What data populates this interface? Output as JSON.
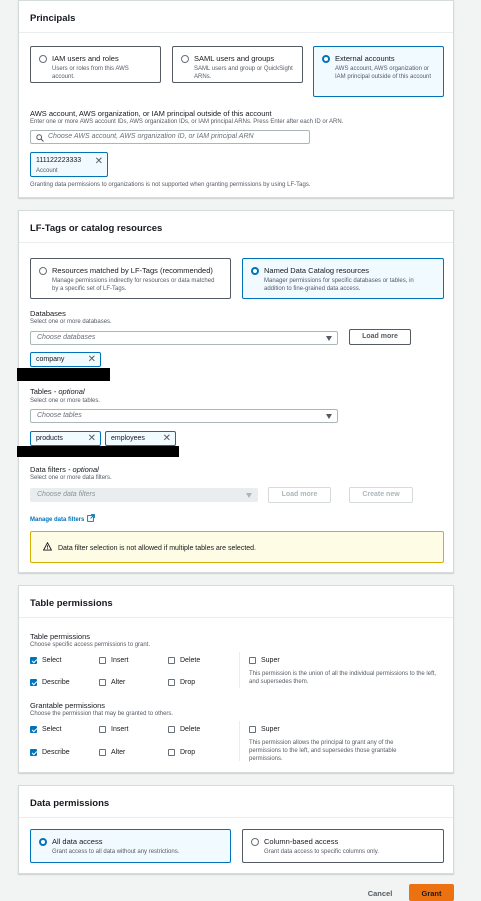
{
  "principals": {
    "title": "Principals",
    "options": [
      {
        "title": "IAM users and roles",
        "desc": "Users or roles from this AWS account."
      },
      {
        "title": "SAML users and groups",
        "desc": "SAML users and group or QuickSight ARNs."
      },
      {
        "title": "External accounts",
        "desc": "AWS account, AWS organization or IAM principal outside of this account"
      }
    ],
    "account_label": "AWS account, AWS organization, or IAM principal outside of this account",
    "account_desc": "Enter one or more AWS account IDs, AWS organization IDs, or IAM principal ARNs. Press Enter after each ID or ARN.",
    "search_placeholder": "Choose AWS account, AWS organization ID, or IAM principal ARN",
    "token_value": "111122223333",
    "token_sub": "Account",
    "note": "Granting data permissions to organizations is not supported when granting permissions by using LF-Tags."
  },
  "lf": {
    "title": "LF-Tags or catalog resources",
    "options": [
      {
        "title": "Resources matched by LF-Tags (recommended)",
        "desc": "Manage permissions indirectly for resources or data matched by a specific set of LF-Tags."
      },
      {
        "title": "Named Data Catalog resources",
        "desc": "Manager permissions for specific databases or tables, in addition to fine-grained data access."
      }
    ],
    "databases_label": "Databases",
    "databases_desc": "Select one or more databases.",
    "databases_placeholder": "Choose databases",
    "load_more": "Load more",
    "database_token": "company",
    "tables_label": "Tables",
    "tables_optional": "- optional",
    "tables_desc": "Select one or more tables.",
    "tables_placeholder": "Choose tables",
    "table_tokens": [
      "products",
      "employees"
    ],
    "filters_label": "Data filters",
    "filters_optional": "- optional",
    "filters_desc": "Select one or more data filters.",
    "filters_placeholder": "Choose data filters",
    "filters_load_more": "Load more",
    "create_new": "Create new",
    "manage_link": "Manage data filters",
    "warning": "Data filter selection is not allowed if multiple tables are selected."
  },
  "table_perms": {
    "title": "Table permissions",
    "perms_label": "Table permissions",
    "perms_desc": "Choose specific access permissions to grant.",
    "grantable_label": "Grantable permissions",
    "grantable_desc": "Choose the permission that may be granted to others.",
    "items": {
      "select": "Select",
      "insert": "Insert",
      "delete": "Delete",
      "describe": "Describe",
      "alter": "Alter",
      "drop": "Drop",
      "super": "Super"
    },
    "super_desc": "This permission is the union of all the individual permissions to the left, and supersedes them.",
    "super_grant_desc": "This permission allows the principal to grant any of the permissions to the left, and supersedes those grantable permissions."
  },
  "data_perms": {
    "title": "Data permissions",
    "options": [
      {
        "title": "All data access",
        "desc": "Grant access to all data without any restrictions."
      },
      {
        "title": "Column-based access",
        "desc": "Grant data access to specific columns only."
      }
    ]
  },
  "footer": {
    "cancel": "Cancel",
    "grant": "Grant"
  },
  "colors": {
    "accent": "#0073bb",
    "grant": "#ec7211"
  }
}
